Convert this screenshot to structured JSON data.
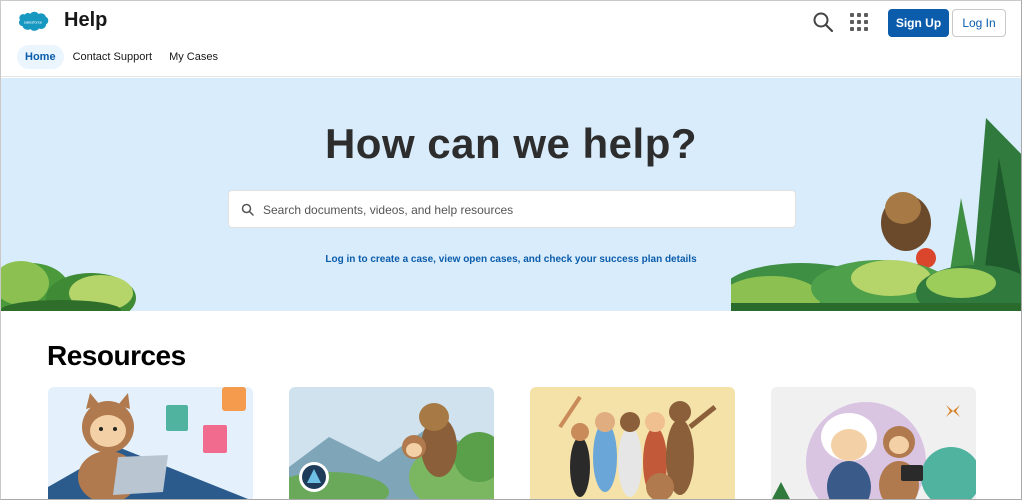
{
  "header": {
    "brand_logo_text": "salesforce",
    "title": "Help",
    "signup_label": "Sign Up",
    "login_label": "Log In"
  },
  "nav": {
    "items": [
      {
        "label": "Home",
        "active": true
      },
      {
        "label": "Contact Support",
        "active": false
      },
      {
        "label": "My Cases",
        "active": false
      }
    ]
  },
  "hero": {
    "title": "How can we help?",
    "search_placeholder": "Search documents, videos, and help resources",
    "login_link": "Log in to create a case, view open cases, and check your success plan details"
  },
  "resources": {
    "title": "Resources",
    "cards": [
      "card-1",
      "card-2",
      "card-3",
      "card-4"
    ]
  },
  "colors": {
    "brand_blue": "#0b5cab",
    "hero_bg": "#d8ecfb",
    "logo_blue": "#1798c1"
  },
  "icons": [
    "salesforce-logo",
    "search-icon",
    "app-launcher-icon"
  ]
}
